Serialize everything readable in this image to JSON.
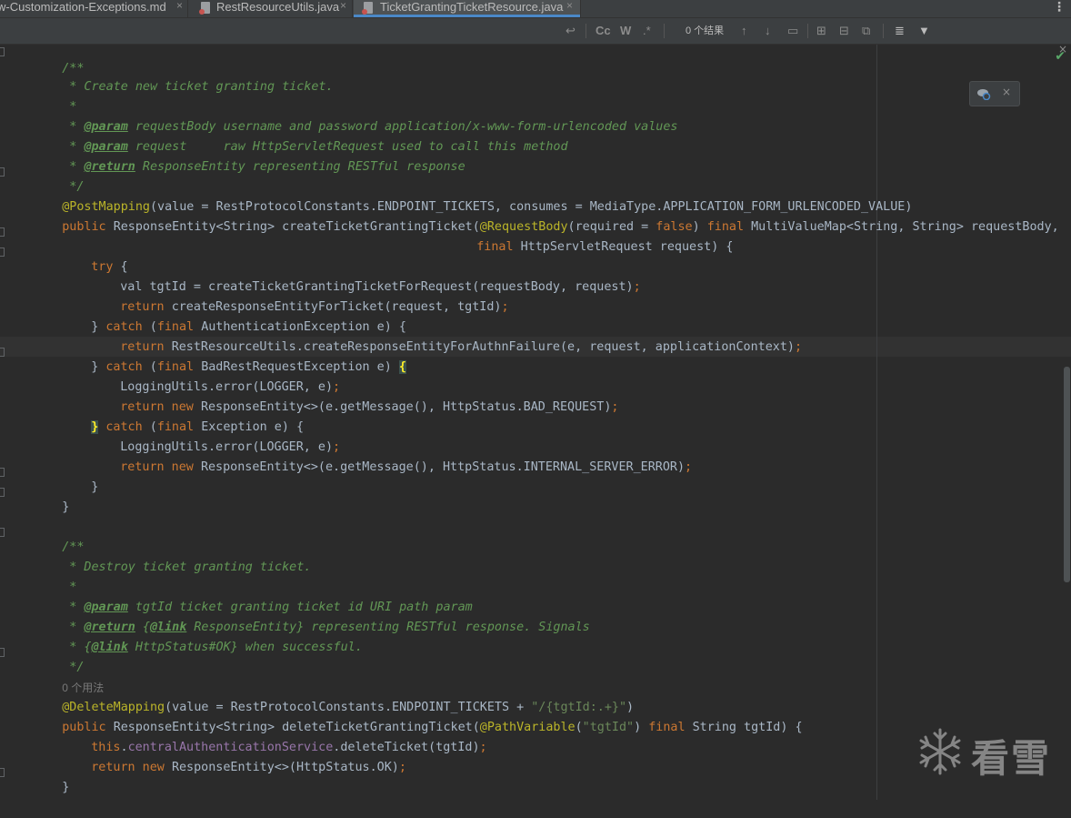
{
  "tabs": [
    {
      "label": "w-Customization-Exceptions.md",
      "close": "×",
      "active": false
    },
    {
      "label": "RestResourceUtils.java",
      "close": "×",
      "active": false
    },
    {
      "label": "TicketGrantingTicketResource.java",
      "close": "×",
      "active": true
    }
  ],
  "find_bar": {
    "match_case": "Cc",
    "words": "W",
    "regex": ".*",
    "results": "0 个结果"
  },
  "colors": {
    "background": "#2b2b2b",
    "keyword": "#cc7832",
    "annotation": "#bbb529",
    "javadoc": "#629755",
    "string": "#6a8759",
    "field": "#9876aa",
    "brace_match": "#ffef28"
  },
  "icons": [
    "kebab-menu-icon",
    "replace-icon",
    "up-arrow-icon",
    "down-arrow-icon",
    "filter-icon",
    "check-icon",
    "close-icon"
  ],
  "code": {
    "l1": "/**",
    "l2": " * Create new ticket granting ticket.",
    "l3": " *",
    "l4a": " * ",
    "l4b": "@param",
    "l4c": " requestBody username and password application/x-www-form-urlencoded values",
    "l5a": " * ",
    "l5b": "@param",
    "l5c": " request     raw HttpServletRequest used to call this method",
    "l6a": " * ",
    "l6b": "@return",
    "l6c": " ResponseEntity representing RESTful response",
    "l7": " */",
    "l8a": "@PostMapping",
    "l8b": "(value = RestProtocolConstants.ENDPOINT_TICKETS, consumes = MediaType.APPLICATION_FORM_URLENCODED_VALUE)",
    "l9a": "public ",
    "l9b": "ResponseEntity<String> createTicketGrantingTicket(",
    "l9c": "@RequestBody",
    "l9d": "(required = ",
    "l9e": "false",
    "l9f": ") ",
    "l9g": "final ",
    "l9h": "MultiValueMap<String, String> requestBody,",
    "l10a": "final ",
    "l10b": "HttpServletRequest request) {",
    "l11a": "try ",
    "l11b": "{",
    "l12a": "val tgtId = createTicketGrantingTicketForRequest(requestBody, request)",
    "l12b": ";",
    "l13a": "return ",
    "l13b": "createResponseEntityForTicket(request, tgtId)",
    "l13c": ";",
    "l14a": "} ",
    "l14b": "catch ",
    "l14c": "(",
    "l14d": "final ",
    "l14e": "AuthenticationException e) {",
    "l15a": "return ",
    "l15b": "RestResourceUtils.createResponseEntityForAuthnFailure(e, request, applicationContext)",
    "l15c": ";",
    "l16a": "} ",
    "l16b": "catch ",
    "l16c": "(",
    "l16d": "final ",
    "l16e": "BadRestRequestException e) ",
    "l16f": "{",
    "l17a": "LoggingUtils.error(LOGGER, e)",
    "l17b": ";",
    "l18a": "return new ",
    "l18b": "ResponseEntity<>(e.getMessage(), HttpStatus.BAD_REQUEST)",
    "l18c": ";",
    "l19a": "}",
    "l19b": " catch ",
    "l19c": "(",
    "l19d": "final ",
    "l19e": "Exception e) {",
    "l20a": "LoggingUtils.error(LOGGER, e)",
    "l20b": ";",
    "l21a": "return new ",
    "l21b": "ResponseEntity<>(e.getMessage(), HttpStatus.INTERNAL_SERVER_ERROR)",
    "l21c": ";",
    "l22": "}",
    "l23": "}",
    "l25": "/**",
    "l26": " * Destroy ticket granting ticket.",
    "l27": " *",
    "l28a": " * ",
    "l28b": "@param",
    "l28c": " tgtId ticket granting ticket id URI path param",
    "l29a": " * ",
    "l29b": "@return",
    "l29c": " {",
    "l29d": "@link",
    "l29e": " ResponseEntity} representing RESTful response. Signals",
    "l30a": " * {",
    "l30b": "@link",
    "l30c": " HttpStatus#OK} when successful.",
    "l31": " */",
    "l32": "0 个用法",
    "l33a": "@DeleteMapping",
    "l33b": "(value = RestProtocolConstants.ENDPOINT_TICKETS + ",
    "l33c": "\"/{tgtId:.+}\"",
    "l33d": ")",
    "l34a": "public ",
    "l34b": "ResponseEntity<String> deleteTicketGrantingTicket(",
    "l34c": "@PathVariable",
    "l34d": "(",
    "l34e": "\"tgtId\"",
    "l34f": ") ",
    "l34g": "final ",
    "l34h": "String tgtId) {",
    "l35a": "this",
    "l35b": ".",
    "l35c": "centralAuthenticationService",
    "l35d": ".deleteTicket(tgtId)",
    "l35e": ";",
    "l36a": "return new ",
    "l36b": "ResponseEntity<>(HttpStatus.OK)",
    "l36c": ";",
    "l37": "}"
  },
  "watermark": {
    "text": "看雪"
  }
}
